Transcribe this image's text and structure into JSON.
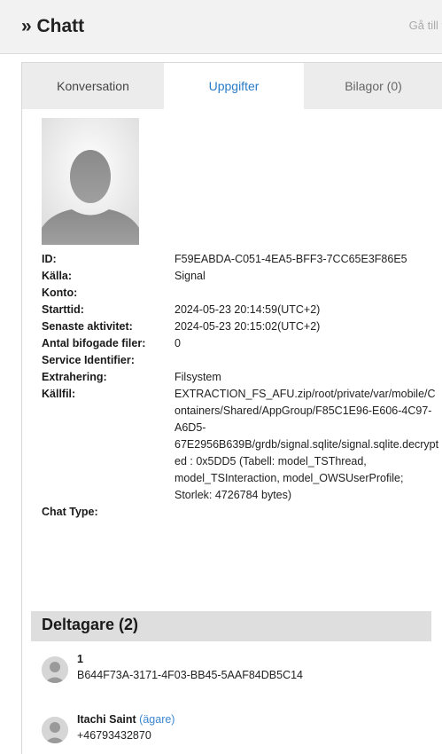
{
  "header": {
    "title": "» Chatt",
    "goto_label": "Gå till ▾"
  },
  "tabs": [
    "Konversation",
    "Uppgifter",
    "Bilagor (0)"
  ],
  "details": [
    {
      "label": "ID:",
      "value": "F59EABDA-C051-4EA5-BFF3-7CC65E3F86E5"
    },
    {
      "label": "Källa:",
      "value": "Signal"
    },
    {
      "label": "Konto:",
      "value": ""
    },
    {
      "label": "Starttid:",
      "value": "2024-05-23 20:14:59(UTC+2)"
    },
    {
      "label": "Senaste aktivitet:",
      "value": "2024-05-23 20:15:02(UTC+2)"
    },
    {
      "label": "Antal bifogade filer:",
      "value": "0"
    },
    {
      "label": "Service Identifier:",
      "value": ""
    },
    {
      "label": "Extrahering:",
      "value": "Filsystem"
    },
    {
      "label": "Källfil:",
      "value": "EXTRACTION_FS_AFU.zip/root/private/var/mobile/Containers/Shared/AppGroup/F85C1E96-E606-4C97-A6D5-67E2956B639B/grdb/signal.sqlite/signal.sqlite.decrypted : 0x5DD5 (Tabell: model_TSThread, model_TSInteraction, model_OWSUserProfile; Storlek: 4726784 bytes)"
    },
    {
      "label": "Chat Type:",
      "value": ""
    }
  ],
  "participants_section": {
    "title": "Deltagare (2)"
  },
  "participants": [
    {
      "name": "1",
      "owner_label": "",
      "identifier": "B644F73A-3171-4F03-BB45-5AAF84DB5C14"
    },
    {
      "name": "Itachi Saint",
      "owner_label": "(ägare)",
      "identifier": "+46793432870"
    }
  ]
}
